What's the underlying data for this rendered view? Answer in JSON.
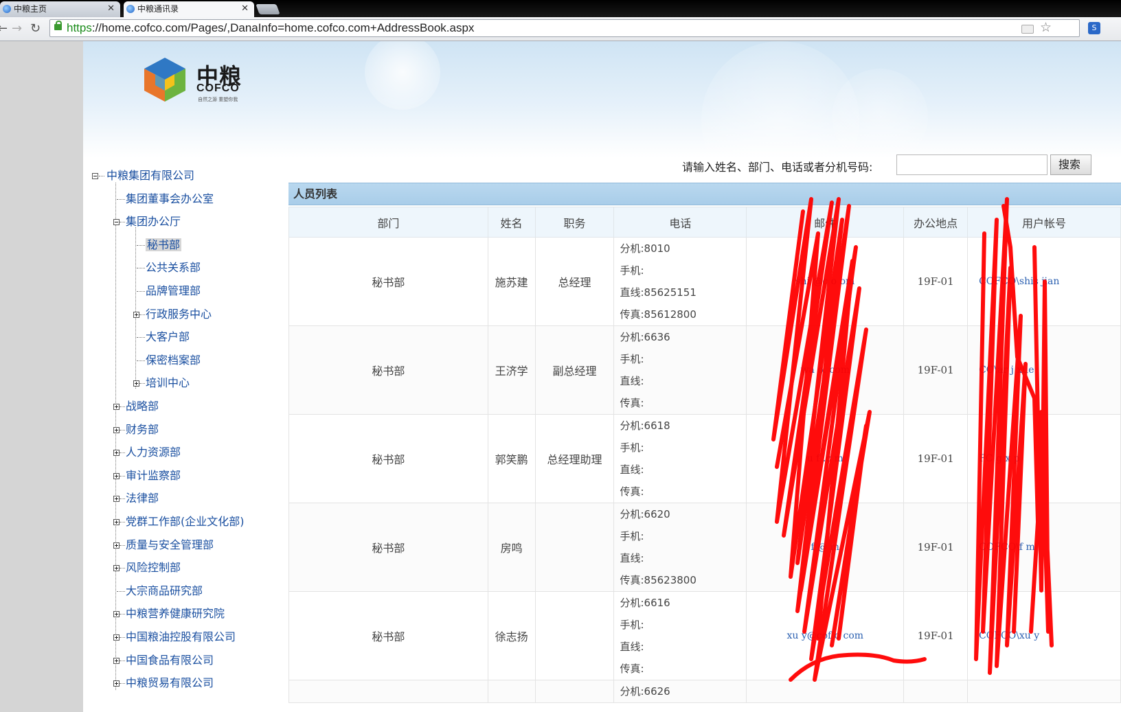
{
  "browser": {
    "tabs": [
      {
        "title": "中粮主页",
        "active": false
      },
      {
        "title": "中粮通讯录",
        "active": true
      }
    ],
    "url_scheme": "https",
    "url_rest": "://home.cofco.com/Pages/,DanaInfo=home.cofco.com+AddressBook.aspx"
  },
  "header": {
    "logo_cn": "中粮",
    "logo_en": "COFCO",
    "logo_tag": "自然之源 重塑你我",
    "logo_icon": "cofco-cube-icon"
  },
  "search": {
    "label": "请输入姓名、部门、电话或者分机号码:",
    "value": "",
    "button_label": "搜索"
  },
  "tree": {
    "root": "中粮集团有限公司",
    "items": [
      {
        "label": "集团董事会办公室",
        "level": 1,
        "toggle": "none"
      },
      {
        "label": "集团办公厅",
        "level": 1,
        "toggle": "minus"
      },
      {
        "label": "秘书部",
        "level": 2,
        "toggle": "none",
        "selected": true
      },
      {
        "label": "公共关系部",
        "level": 2,
        "toggle": "none"
      },
      {
        "label": "品牌管理部",
        "level": 2,
        "toggle": "none"
      },
      {
        "label": "行政服务中心",
        "level": 2,
        "toggle": "plus"
      },
      {
        "label": "大客户部",
        "level": 2,
        "toggle": "none"
      },
      {
        "label": "保密档案部",
        "level": 2,
        "toggle": "none"
      },
      {
        "label": "培训中心",
        "level": 2,
        "toggle": "plus"
      },
      {
        "label": "战略部",
        "level": 1,
        "toggle": "plus"
      },
      {
        "label": "财务部",
        "level": 1,
        "toggle": "plus"
      },
      {
        "label": "人力资源部",
        "level": 1,
        "toggle": "plus"
      },
      {
        "label": "审计监察部",
        "level": 1,
        "toggle": "plus"
      },
      {
        "label": "法律部",
        "level": 1,
        "toggle": "plus"
      },
      {
        "label": "党群工作部(企业文化部)",
        "level": 1,
        "toggle": "plus"
      },
      {
        "label": "质量与安全管理部",
        "level": 1,
        "toggle": "plus"
      },
      {
        "label": "风险控制部",
        "level": 1,
        "toggle": "plus"
      },
      {
        "label": "大宗商品研究部",
        "level": 1,
        "toggle": "none"
      },
      {
        "label": "中粮营养健康研究院",
        "level": 1,
        "toggle": "plus"
      },
      {
        "label": "中国粮油控股有限公司",
        "level": 1,
        "toggle": "plus"
      },
      {
        "label": "中国食品有限公司",
        "level": 1,
        "toggle": "plus"
      },
      {
        "label": "中粮贸易有限公司",
        "level": 1,
        "toggle": "plus"
      }
    ]
  },
  "grid": {
    "title": "人员列表",
    "columns": [
      "部门",
      "姓名",
      "职务",
      "电话",
      "邮件",
      "办公地点",
      "用户帐号"
    ],
    "rows": [
      {
        "dept": "秘书部",
        "name": "施苏建",
        "title": "总经理",
        "phones": [
          "分机:8010",
          "手机:",
          "直线:85625151",
          "传真:85612800"
        ],
        "email": "shi @c o om",
        "office": "19F-01",
        "account": "COFCO\\shis jian"
      },
      {
        "dept": "秘书部",
        "name": "王济学",
        "title": "副总经理",
        "phones": [
          "分机:6636",
          "手机:",
          "直线:",
          "传真:"
        ],
        "email": "wa o. com",
        "office": "19F-01",
        "account": "CO\\ar j xue"
      },
      {
        "dept": "秘书部",
        "name": "郭笑鹏",
        "title": "总经理助理",
        "phones": [
          "分机:6618",
          "手机:",
          "直线:",
          "传真:"
        ],
        "email": "u f .c m",
        "office": "19F-01",
        "account": "FC g x p"
      },
      {
        "dept": "秘书部",
        "name": "房鸣",
        "title": "",
        "phones": [
          "分机:6620",
          "手机:",
          "直线:",
          "传真:85623800"
        ],
        "email": "f @ m",
        "office": "19F-01",
        "account": "COFCO\\f m"
      },
      {
        "dept": "秘书部",
        "name": "徐志扬",
        "title": "",
        "phones": [
          "分机:6616",
          "手机:",
          "直线:",
          "传真:"
        ],
        "email": "xu y@cof o com",
        "office": "19F-01",
        "account": "COFCO\\xu y"
      },
      {
        "dept": "",
        "name": "",
        "title": "",
        "phones": [
          "分机:6626"
        ],
        "email": "",
        "office": "",
        "account": ""
      }
    ]
  },
  "colors": {
    "link": "#1a4fa0",
    "grid_title_bg": "#a9cde9",
    "header_bg": "#eef6fc",
    "scribble": "#ff0000"
  }
}
